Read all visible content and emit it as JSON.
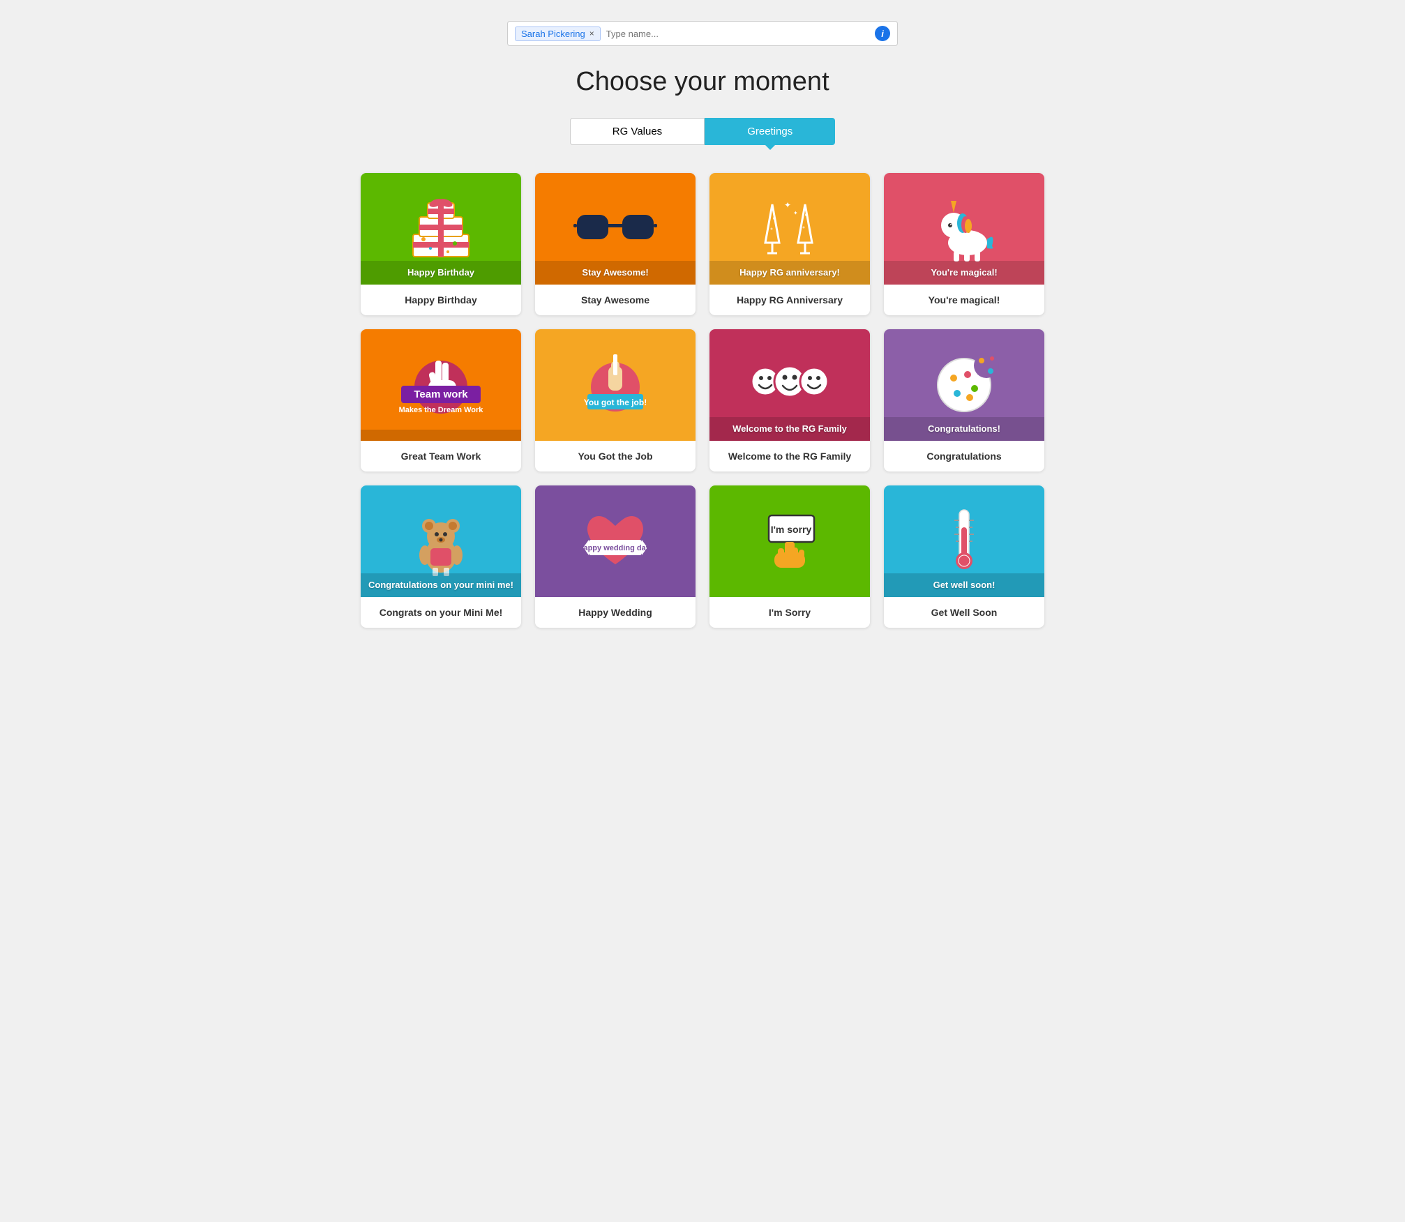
{
  "search": {
    "tag_label": "Sarah Pickering",
    "tag_close": "×",
    "placeholder": "Type name...",
    "info_icon": "i"
  },
  "page": {
    "title": "Choose your moment"
  },
  "tabs": [
    {
      "id": "rg-values",
      "label": "RG Values",
      "active": false
    },
    {
      "id": "greetings",
      "label": "Greetings",
      "active": true
    }
  ],
  "cards": [
    {
      "id": "happy-birthday",
      "bg": "bg-green",
      "image_text": "Happy Birthday",
      "label": "Happy Birthday",
      "icon": "gift"
    },
    {
      "id": "stay-awesome",
      "bg": "bg-orange",
      "image_text": "Stay Awesome!",
      "label": "Stay Awesome",
      "icon": "sunglasses"
    },
    {
      "id": "happy-rg-anniversary",
      "bg": "bg-yellow",
      "image_text": "Happy RG anniversary!",
      "label": "Happy RG Anniversary",
      "icon": "champagne"
    },
    {
      "id": "youre-magical",
      "bg": "bg-pink",
      "image_text": "You're magical!",
      "label": "You're magical!",
      "icon": "unicorn"
    },
    {
      "id": "great-team-work",
      "bg": "bg-orange2",
      "image_text_main": "Team work",
      "image_text_sub": "Makes the Dream Work",
      "label": "Great Team Work",
      "icon": "teamwork"
    },
    {
      "id": "you-got-the-job",
      "bg": "bg-yellow2",
      "image_text": "You got the job!",
      "label": "You Got the Job",
      "icon": "pencil"
    },
    {
      "id": "welcome-rg-family",
      "bg": "bg-crimson",
      "image_text": "Welcome to the RG Family",
      "label": "Welcome to the RG Family",
      "icon": "faces"
    },
    {
      "id": "congratulations",
      "bg": "bg-purple",
      "image_text": "Congratulations!",
      "label": "Congratulations",
      "icon": "cookie"
    },
    {
      "id": "congrats-mini-me",
      "bg": "bg-blue",
      "image_text": "Congratulations on your mini me!",
      "label": "Congrats on your Mini Me!",
      "icon": "bear"
    },
    {
      "id": "happy-wedding",
      "bg": "bg-purple2",
      "image_text": "Happy wedding day!",
      "label": "Happy Wedding",
      "icon": "heart"
    },
    {
      "id": "im-sorry",
      "bg": "bg-green2",
      "image_text": "I'm sorry",
      "label": "I'm Sorry",
      "icon": "sign"
    },
    {
      "id": "get-well-soon",
      "bg": "bg-blue2",
      "image_text": "Get well soon!",
      "label": "Get Well Soon",
      "icon": "thermometer"
    }
  ]
}
